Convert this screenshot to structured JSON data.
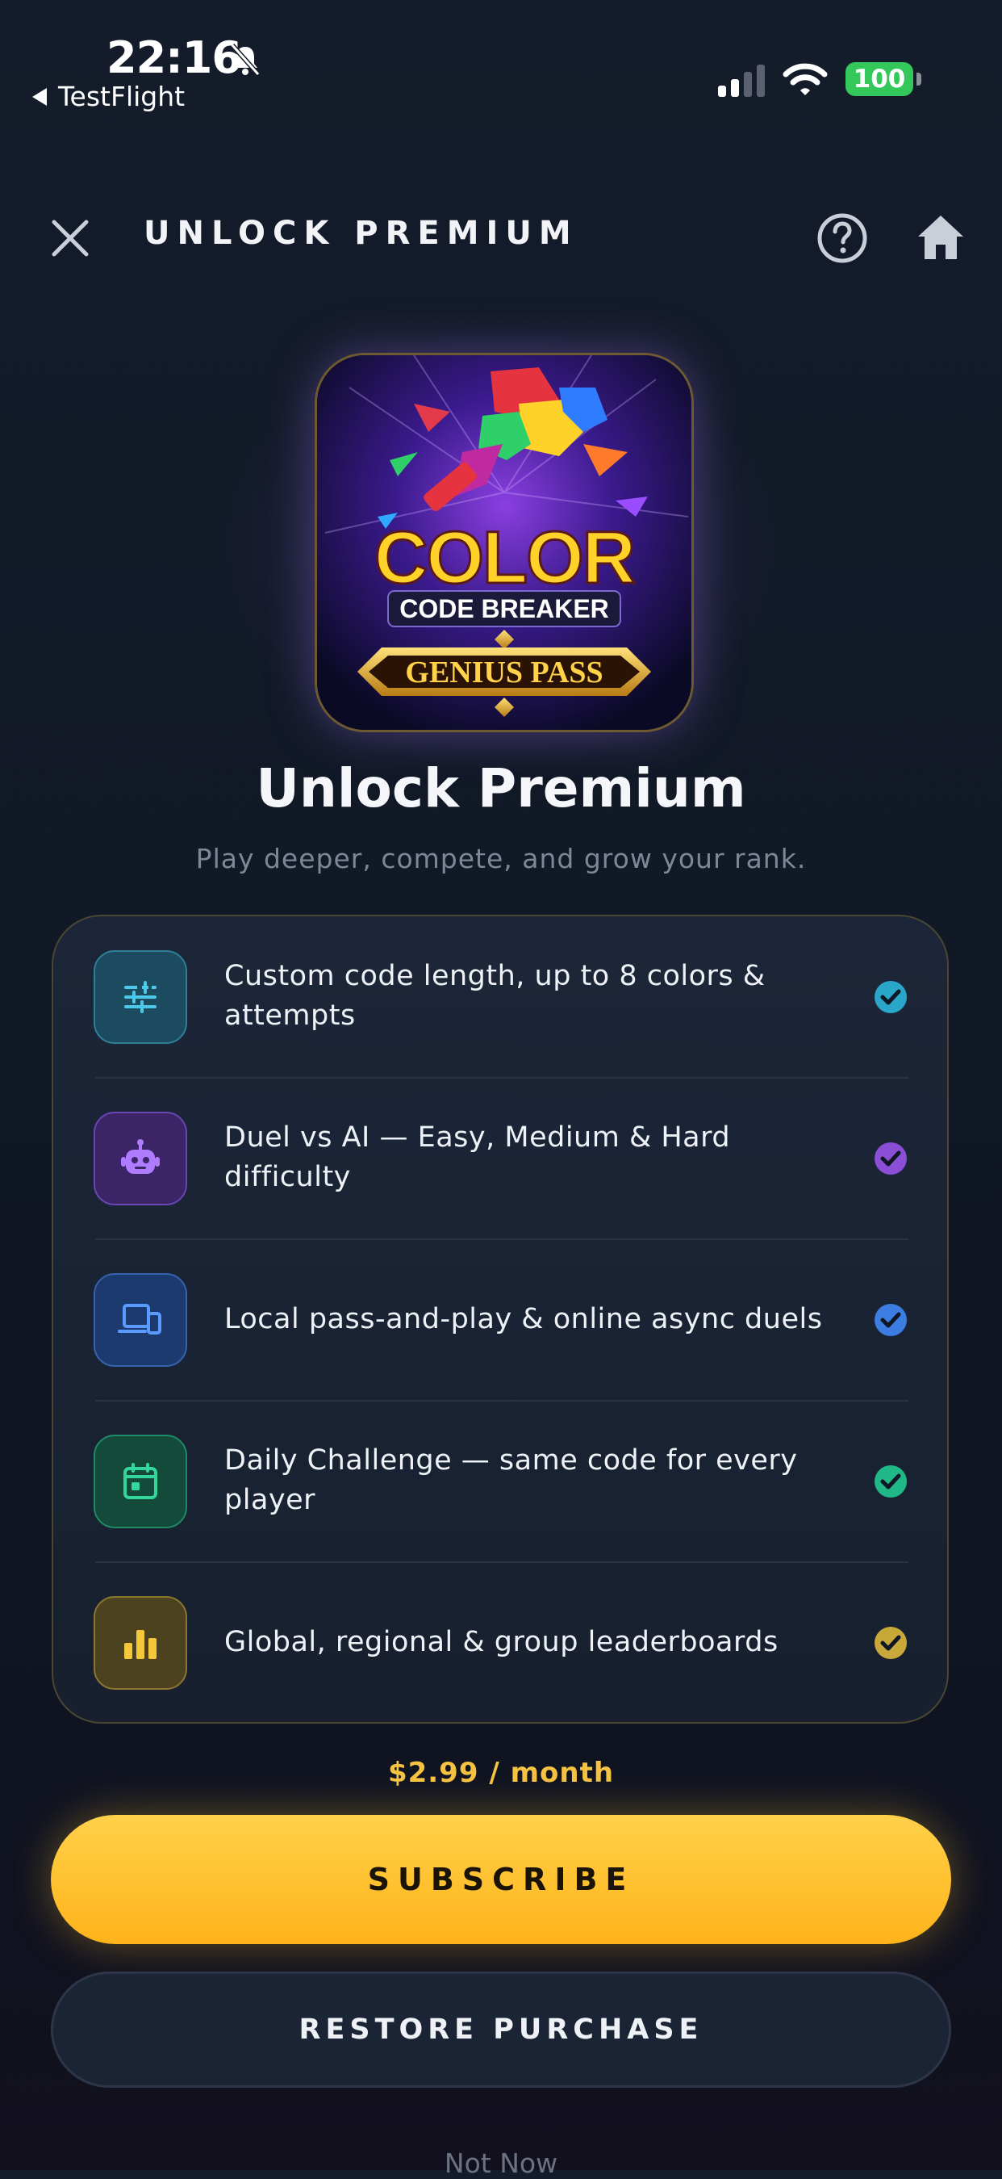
{
  "status_bar": {
    "time": "22:16",
    "back_label": "TestFlight",
    "battery": "100",
    "icons": [
      "bell-slash-icon",
      "signal-icon",
      "wifi-icon",
      "battery-icon"
    ]
  },
  "header": {
    "title": "UNLOCK PREMIUM",
    "icons": [
      "close-icon",
      "help-icon",
      "home-icon"
    ]
  },
  "hero": {
    "image_text": {
      "line1": "COLOR",
      "line2": "CODE BREAKER",
      "line3": "GENIUS PASS"
    },
    "title": "Unlock Premium",
    "subtitle": "Play deeper, compete, and grow your rank."
  },
  "features": [
    {
      "icon": "sliders-icon",
      "text": "Custom code length, up to 8 colors & attempts",
      "accent": "#2aa6c9"
    },
    {
      "icon": "robot-icon",
      "text": "Duel vs AI — Easy, Medium & Hard difficulty",
      "accent": "#8a4fd6"
    },
    {
      "icon": "devices-icon",
      "text": "Local pass-and-play & online async duels",
      "accent": "#3b7de0"
    },
    {
      "icon": "calendar-icon",
      "text": "Daily Challenge — same code for every player",
      "accent": "#1fb886"
    },
    {
      "icon": "bar-chart-icon",
      "text": "Global, regional & group leaderboards",
      "accent": "#e0b531"
    }
  ],
  "pricing": {
    "price": "$2.99 / month",
    "subscribe_label": "SUBSCRIBE",
    "restore_label": "RESTORE PURCHASE",
    "not_now_label": "Not Now"
  }
}
